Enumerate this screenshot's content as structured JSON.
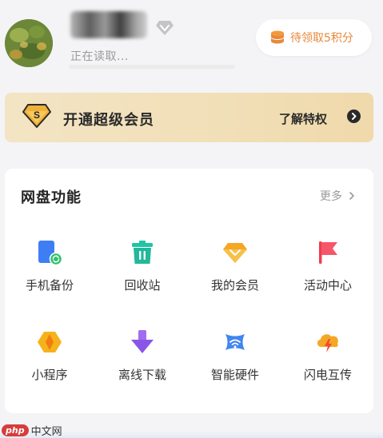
{
  "profile": {
    "reading_status": "正在读取...",
    "points_label": "待领取5积分"
  },
  "vip_banner": {
    "title": "开通超级会员",
    "learn_more": "了解特权",
    "badge_letter": "S"
  },
  "features": {
    "title": "网盘功能",
    "more": "更多",
    "items": [
      {
        "label": "手机备份",
        "icon": "phone-backup-icon",
        "color": "#3d7ef5"
      },
      {
        "label": "回收站",
        "icon": "recycle-bin-icon",
        "color": "#1fc4a6"
      },
      {
        "label": "我的会员",
        "icon": "vip-diamond-icon",
        "color": "#f5a623"
      },
      {
        "label": "活动中心",
        "icon": "flag-icon",
        "color": "#f03c4e"
      },
      {
        "label": "小程序",
        "icon": "mini-program-icon",
        "color": "#f6b21a"
      },
      {
        "label": "离线下载",
        "icon": "download-icon",
        "color": "#8a56e8"
      },
      {
        "label": "智能硬件",
        "icon": "smart-hardware-icon",
        "color": "#3f86f0"
      },
      {
        "label": "闪电互传",
        "icon": "lightning-transfer-icon",
        "color": "#f5a623"
      }
    ]
  },
  "watermark": {
    "brand": "php",
    "site": "中文网"
  },
  "colors": {
    "accent_orange": "#e8883a",
    "banner_gold": "#f1dfb7",
    "background": "#f4f4f6"
  }
}
